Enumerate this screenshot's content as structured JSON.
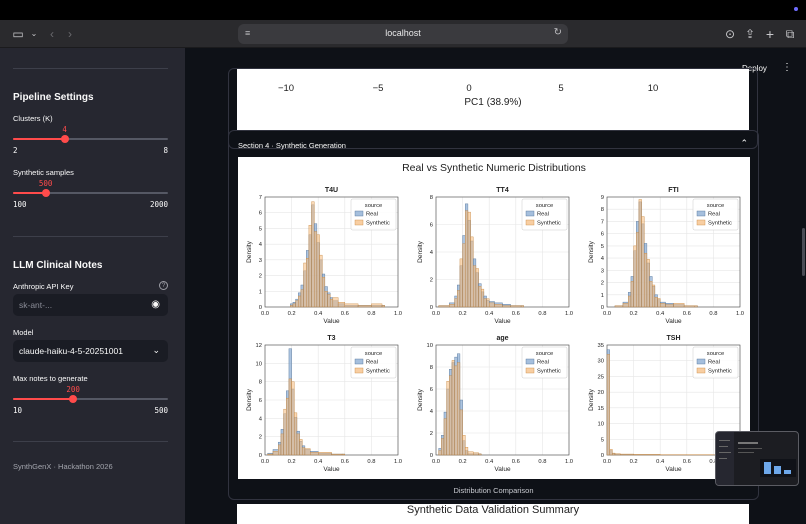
{
  "browser": {
    "url": "localhost"
  },
  "sidebar": {
    "pipeline_heading": "Pipeline Settings",
    "clusters": {
      "label": "Clusters (K)",
      "min": 2,
      "max": 8,
      "value": 4
    },
    "synthetic_samples": {
      "label": "Synthetic samples",
      "min": 100,
      "max": 2000,
      "value": 500
    },
    "llm_heading": "LLM Clinical Notes",
    "api_key": {
      "label": "Anthropic API Key",
      "placeholder": "sk-ant-..."
    },
    "model": {
      "label": "Model",
      "selected": "claude-haiku-4-5-20251001"
    },
    "max_notes": {
      "label": "Max notes to generate",
      "min": 10,
      "max": 500,
      "value": 200
    },
    "footer": "SynthGenX · Hackathon 2026"
  },
  "header": {
    "deploy_label": "Deploy",
    "menu_glyph": "⋮"
  },
  "pca": {
    "ticks": [
      "−10",
      "−5",
      "0",
      "5",
      "10"
    ],
    "xlabel": "PC1 (38.9%)"
  },
  "section4": {
    "title": "Section 4 · Synthetic Generation",
    "caption": "Distribution Comparison"
  },
  "next_section": {
    "title": "Synthetic Data Validation Summary"
  },
  "colors": {
    "real": "#7fa4cf",
    "synthetic": "#f5b97a",
    "accent": "#ff4b4b"
  },
  "chart_data": {
    "type": "histogram-grid",
    "title": "Real vs Synthetic Numeric Distributions",
    "legend_title": "source",
    "legend_entries": [
      "Real",
      "Synthetic"
    ],
    "legend_placement": "top-right",
    "xlabel": "Value",
    "ylabel": "Density",
    "x_ticks": [
      "0.0",
      "0.2",
      "0.4",
      "0.6",
      "0.8",
      "1.0"
    ],
    "xlim": [
      0,
      1
    ],
    "panels": [
      {
        "title": "T4U",
        "ylim": [
          0,
          7
        ],
        "y_ticks": [
          0,
          1,
          2,
          3,
          4,
          5,
          6,
          7
        ],
        "bins": [
          0.19,
          0.21,
          0.23,
          0.25,
          0.27,
          0.29,
          0.31,
          0.33,
          0.35,
          0.37,
          0.39,
          0.41,
          0.43,
          0.45,
          0.47,
          0.49,
          0.51,
          0.55,
          0.6,
          0.7,
          0.8,
          0.88
        ],
        "real": [
          0.2,
          0.3,
          0.5,
          0.9,
          1.4,
          2.3,
          3.6,
          4.6,
          6.5,
          5.3,
          4.1,
          3.0,
          2.1,
          1.3,
          0.9,
          0.6,
          0.4,
          0.2,
          0.1,
          0.1,
          0.1,
          0.1
        ],
        "synthetic": [
          0.1,
          0.2,
          0.4,
          0.7,
          1.1,
          2.8,
          3.1,
          5.2,
          6.7,
          4.8,
          4.6,
          3.3,
          1.9,
          1.0,
          0.8,
          0.5,
          0.6,
          0.3,
          0.2,
          0.1,
          0.2,
          0.1
        ]
      },
      {
        "title": "TT4",
        "ylim": [
          0,
          8
        ],
        "y_ticks": [
          0,
          2,
          4,
          6,
          8
        ],
        "bins": [
          0.02,
          0.1,
          0.14,
          0.16,
          0.18,
          0.2,
          0.22,
          0.24,
          0.26,
          0.28,
          0.3,
          0.32,
          0.34,
          0.36,
          0.38,
          0.4,
          0.44,
          0.5,
          0.56,
          0.64
        ],
        "real": [
          0.1,
          0.3,
          0.8,
          1.6,
          3.0,
          5.2,
          7.5,
          6.3,
          4.8,
          3.5,
          2.5,
          1.7,
          1.1,
          0.8,
          0.5,
          0.4,
          0.3,
          0.2,
          0.1,
          0.1
        ],
        "synthetic": [
          0.1,
          0.2,
          0.6,
          1.2,
          3.5,
          4.6,
          7.0,
          6.9,
          5.1,
          3.0,
          2.8,
          1.5,
          1.3,
          0.6,
          0.6,
          0.3,
          0.2,
          0.1,
          0.1,
          0.1
        ]
      },
      {
        "title": "FTI",
        "ylim": [
          0,
          9
        ],
        "y_ticks": [
          0,
          1,
          2,
          3,
          4,
          5,
          6,
          7,
          8,
          9
        ],
        "bins": [
          0.06,
          0.12,
          0.16,
          0.18,
          0.2,
          0.22,
          0.24,
          0.26,
          0.28,
          0.3,
          0.32,
          0.34,
          0.36,
          0.38,
          0.4,
          0.44,
          0.5,
          0.58,
          0.66
        ],
        "real": [
          0.1,
          0.4,
          1.2,
          2.5,
          4.6,
          7.0,
          8.6,
          6.8,
          5.2,
          3.6,
          2.5,
          1.7,
          1.0,
          0.6,
          0.4,
          0.3,
          0.2,
          0.1,
          0.1
        ],
        "synthetic": [
          0.1,
          0.3,
          0.9,
          2.1,
          5.0,
          6.1,
          8.8,
          7.4,
          4.4,
          3.9,
          2.1,
          1.8,
          0.8,
          0.7,
          0.3,
          0.2,
          0.3,
          0.1,
          0.1
        ]
      },
      {
        "title": "T3",
        "ylim": [
          0,
          12
        ],
        "y_ticks": [
          0,
          2,
          4,
          6,
          8,
          10,
          12
        ],
        "bins": [
          0.02,
          0.06,
          0.1,
          0.12,
          0.14,
          0.16,
          0.18,
          0.2,
          0.22,
          0.24,
          0.26,
          0.28,
          0.3,
          0.34,
          0.4,
          0.5,
          0.58
        ],
        "real": [
          0.2,
          0.6,
          1.4,
          2.8,
          4.5,
          7.0,
          11.6,
          7.2,
          4.1,
          2.6,
          1.5,
          1.0,
          0.6,
          0.4,
          0.2,
          0.1,
          0.1
        ],
        "synthetic": [
          0.1,
          0.4,
          1.1,
          2.3,
          5.0,
          6.2,
          8.3,
          8.0,
          4.6,
          2.3,
          1.7,
          0.8,
          0.7,
          0.3,
          0.3,
          0.1,
          0.1
        ]
      },
      {
        "title": "age",
        "ylim": [
          0,
          10
        ],
        "y_ticks": [
          0,
          2,
          4,
          6,
          8,
          10
        ],
        "bins": [
          0.02,
          0.04,
          0.06,
          0.08,
          0.1,
          0.12,
          0.14,
          0.16,
          0.18,
          0.2,
          0.22,
          0.24,
          0.28,
          0.32
        ],
        "real": [
          0.6,
          1.8,
          3.9,
          6.0,
          7.8,
          8.4,
          8.9,
          9.2,
          5.0,
          1.3,
          0.4,
          0.1,
          0.1,
          0.1
        ],
        "synthetic": [
          0.4,
          1.5,
          3.3,
          6.7,
          7.2,
          8.6,
          8.1,
          8.4,
          4.1,
          1.8,
          0.7,
          0.3,
          0.2,
          0.1
        ]
      },
      {
        "title": "TSH",
        "ylim": [
          0,
          35
        ],
        "y_ticks": [
          0,
          5,
          10,
          15,
          20,
          25,
          30,
          35
        ],
        "bins": [
          0.0,
          0.02,
          0.04,
          0.06,
          0.1,
          0.2,
          0.4,
          0.6,
          0.8
        ],
        "real": [
          33.5,
          1.4,
          0.5,
          0.3,
          0.2,
          0.1,
          0.1,
          0.05,
          0.05
        ],
        "synthetic": [
          32.0,
          1.8,
          0.6,
          0.4,
          0.3,
          0.2,
          0.1,
          0.1,
          0.05
        ]
      }
    ]
  }
}
